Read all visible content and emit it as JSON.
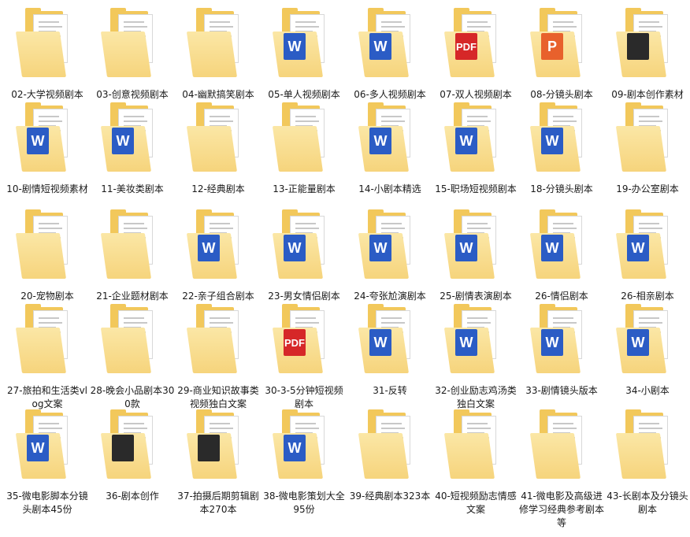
{
  "folders": [
    {
      "label": "02-大学视频剧本",
      "icon": "folder-icon"
    },
    {
      "label": "03-创意视频剧本",
      "icon": "folder-icon"
    },
    {
      "label": "04-幽默搞笑剧本",
      "icon": "folder-icon"
    },
    {
      "label": "05-单人视频剧本",
      "icon": "word-doc-icon"
    },
    {
      "label": "06-多人视频剧本",
      "icon": "word-doc-icon"
    },
    {
      "label": "07-双人视频剧本",
      "icon": "pdf-icon"
    },
    {
      "label": "08-分镜头剧本",
      "icon": "ppt-icon"
    },
    {
      "label": "09-剧本创作素材",
      "icon": "image-icon"
    },
    {
      "label": "10-剧情短视频素材",
      "icon": "word-doc-icon"
    },
    {
      "label": "11-美妆类剧本",
      "icon": "word-doc-icon"
    },
    {
      "label": "12-经典剧本",
      "icon": "folder-icon"
    },
    {
      "label": "13-正能量剧本",
      "icon": "folder-icon"
    },
    {
      "label": "14-小剧本精选",
      "icon": "word-doc-icon"
    },
    {
      "label": "15-职场短视频剧本",
      "icon": "word-doc-icon"
    },
    {
      "label": "18-分镜头剧本",
      "icon": "word-doc-icon"
    },
    {
      "label": "19-办公室剧本",
      "icon": "folder-icon"
    },
    {
      "label": "20-宠物剧本",
      "icon": "folder-icon"
    },
    {
      "label": "21-企业题材剧本",
      "icon": "folder-icon"
    },
    {
      "label": "22-亲子组合剧本",
      "icon": "word-doc-icon"
    },
    {
      "label": "23-男女情侣剧本",
      "icon": "word-doc-icon"
    },
    {
      "label": "24-夸张尬演剧本",
      "icon": "word-doc-icon"
    },
    {
      "label": "25-剧情表演剧本",
      "icon": "word-doc-icon"
    },
    {
      "label": "26-情侣剧本",
      "icon": "word-doc-icon"
    },
    {
      "label": "26-相亲剧本",
      "icon": "word-doc-icon"
    },
    {
      "label": "27-旅拍和生活类vlog文案",
      "icon": "folder-icon"
    },
    {
      "label": "28-晚会小品剧本300款",
      "icon": "folder-icon"
    },
    {
      "label": "29-商业知识故事类视频独白文案",
      "icon": "folder-icon"
    },
    {
      "label": "30-3-5分钟短视频剧本",
      "icon": "pdf-icon"
    },
    {
      "label": "31-反转",
      "icon": "word-doc-icon"
    },
    {
      "label": "32-创业励志鸡汤类独白文案",
      "icon": "word-doc-icon"
    },
    {
      "label": "33-剧情镜头版本",
      "icon": "word-doc-icon"
    },
    {
      "label": "34-小剧本",
      "icon": "word-doc-icon"
    },
    {
      "label": "35-微电影脚本分镜头剧本45份",
      "icon": "word-doc-icon"
    },
    {
      "label": "36-剧本创作",
      "icon": "image-icon"
    },
    {
      "label": "37-拍摄后期剪辑剧本270本",
      "icon": "image-icon"
    },
    {
      "label": "38-微电影策划大全95份",
      "icon": "word-doc-icon"
    },
    {
      "label": "39-经典剧本323本",
      "icon": "folder-icon"
    },
    {
      "label": "40-短视频励志情感文案",
      "icon": "folder-icon"
    },
    {
      "label": "41-微电影及高级进修学习经典参考剧本等",
      "icon": "folder-icon"
    },
    {
      "label": "43-长剧本及分镜头剧本",
      "icon": "folder-icon"
    }
  ],
  "colors": {
    "folder": "#f2c85b",
    "folder_front": "#f6d47c",
    "word": "#2b5cc5",
    "pdf": "#d62728",
    "ppt": "#e8612c"
  }
}
